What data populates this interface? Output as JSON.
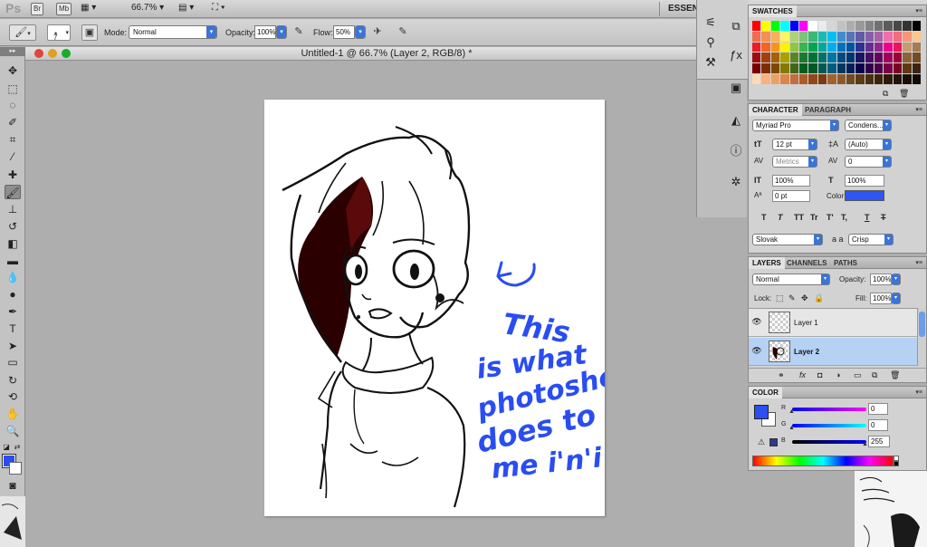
{
  "app_bar": {
    "logo": "Ps",
    "bridge_btn": "Br",
    "minibridge_btn": "Mb",
    "zoom": "66.7%",
    "workspace": "ESSEN"
  },
  "options_bar": {
    "brush_size": "7",
    "mode_label": "Mode:",
    "mode_value": "Normal",
    "opacity_label": "Opacity:",
    "opacity_value": "100%",
    "flow_label": "Flow:",
    "flow_value": "50%"
  },
  "document": {
    "title": "Untitled-1 @ 66.7% (Layer 2, RGB/8) *"
  },
  "canvas": {
    "handwritten_note": [
      "This",
      "is what",
      "photoshop",
      "does to",
      "me i'n'i"
    ]
  },
  "swatches": {
    "tab": "SWATCHES",
    "colors": [
      "#ff0000",
      "#ffff00",
      "#00ff00",
      "#00ffff",
      "#0000ff",
      "#ff00ff",
      "#ffffff",
      "#ebebeb",
      "#d6d6d6",
      "#c2c2c2",
      "#adadad",
      "#999999",
      "#858585",
      "#707070",
      "#5c5c5c",
      "#474747",
      "#333333",
      "#000000",
      "#f26c4f",
      "#f68e55",
      "#fbaf5d",
      "#fff467",
      "#acd372",
      "#7cc576",
      "#3bb878",
      "#1abbb4",
      "#00bff3",
      "#438cca",
      "#5574b9",
      "#605ca8",
      "#855fa8",
      "#a763a8",
      "#f06ea9",
      "#f26d7d",
      "#f7977a",
      "#fdc68a",
      "#ed1c24",
      "#f26522",
      "#f7941d",
      "#fff200",
      "#8dc73f",
      "#39b54a",
      "#00a651",
      "#00a99d",
      "#00aeef",
      "#0072bc",
      "#0054a6",
      "#2e3192",
      "#662d91",
      "#92278f",
      "#ec008c",
      "#ed145b",
      "#c69c6e",
      "#a67c52",
      "#9e0b0f",
      "#a0410d",
      "#a3620a",
      "#aba000",
      "#598527",
      "#1a7b30",
      "#007236",
      "#00746b",
      "#0076a3",
      "#004b80",
      "#003471",
      "#1b1464",
      "#440e62",
      "#630460",
      "#9e005d",
      "#9e0039",
      "#8c6239",
      "#754c24",
      "#790000",
      "#7b2e00",
      "#7d4900",
      "#827b00",
      "#406618",
      "#005e20",
      "#005826",
      "#005952",
      "#005b7f",
      "#003663",
      "#002157",
      "#0d004c",
      "#32004b",
      "#4b0049",
      "#7b0046",
      "#7a0026",
      "#603913",
      "#3c2415",
      "#fdd9b5",
      "#f9b27b",
      "#e8a267",
      "#d8864b",
      "#c26f3c",
      "#ab5a2a",
      "#904719",
      "#7a3a12",
      "#a0632c",
      "#8a5a2c",
      "#6f4a22",
      "#5a3a18",
      "#4a2e12",
      "#3b230c",
      "#2e1a08",
      "#231306",
      "#1a0e04",
      "#120903"
    ]
  },
  "character": {
    "tabs": [
      "CHARACTER",
      "PARAGRAPH"
    ],
    "font_family": "Myriad Pro",
    "font_style": "Condens...",
    "font_size": "12 pt",
    "leading": "(Auto)",
    "kerning": "Metrics",
    "tracking": "0",
    "vertical_scale": "100%",
    "horizontal_scale": "100%",
    "baseline_shift": "0 pt",
    "color_label": "Color:",
    "text_color": "#2f55f2",
    "style_buttons": [
      "T",
      "T",
      "TT",
      "Tr",
      "T'",
      "T,",
      "T",
      "T"
    ],
    "language": "Slovak",
    "aa_label": "a a",
    "antialias": "Crisp"
  },
  "layers": {
    "tabs": [
      "LAYERS",
      "CHANNELS",
      "PATHS"
    ],
    "blend_mode": "Normal",
    "opacity_label": "Opacity:",
    "opacity": "100%",
    "lock_label": "Lock:",
    "fill_label": "Fill:",
    "fill": "100%",
    "items": [
      {
        "name": "Layer 1",
        "selected": false
      },
      {
        "name": "Layer 2",
        "selected": true
      }
    ]
  },
  "color_panel": {
    "tab": "COLOR",
    "foreground": "#2c4ff2",
    "r_label": "R",
    "r_value": "0",
    "g_label": "G",
    "g_value": "0",
    "b_label": "B",
    "b_value": "255"
  },
  "accent": "#3a74d8"
}
